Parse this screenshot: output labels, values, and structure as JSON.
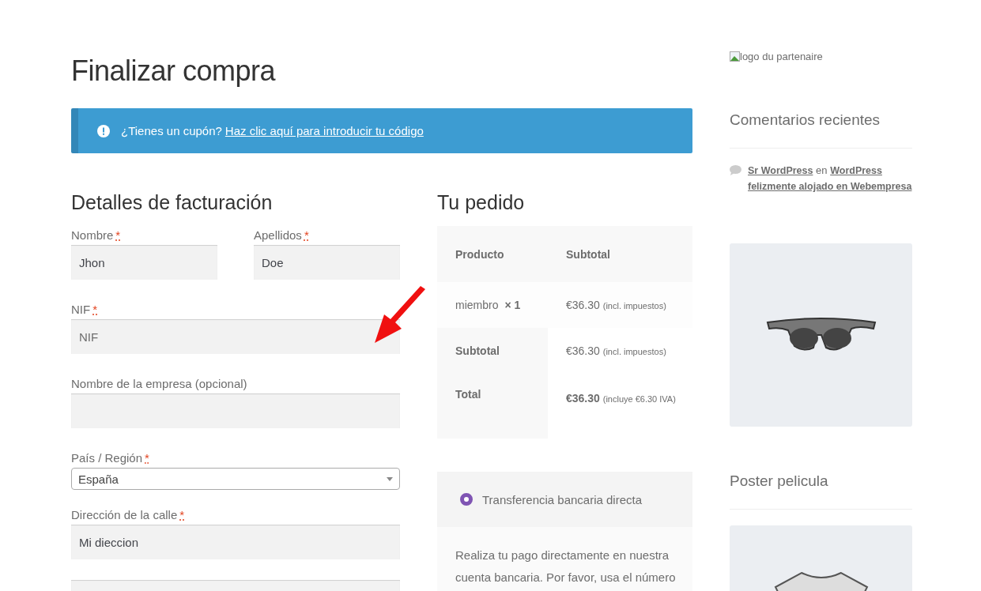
{
  "page_title": "Finalizar compra",
  "notice": {
    "text": "¿Tienes un cupón?",
    "link": "Haz clic aquí para introducir tu código"
  },
  "required_mark": "*",
  "billing": {
    "heading": "Detalles de facturación",
    "rows": [
      [
        {
          "kind": "text",
          "label": "Nombre",
          "required": true,
          "value": "Jhon"
        },
        {
          "kind": "text",
          "label": "Apellidos",
          "required": true,
          "value": "Doe"
        }
      ],
      [
        {
          "kind": "text",
          "label": "NIF",
          "required": true,
          "placeholder": "NIF"
        }
      ],
      [
        {
          "kind": "text",
          "label": "Nombre de la empresa (opcional)",
          "required": false
        }
      ],
      [
        {
          "kind": "select",
          "label": "País / Región",
          "required": true,
          "value": "España"
        }
      ],
      [
        {
          "kind": "text",
          "label": "Dirección de la calle",
          "required": true,
          "value": "Mi dieccion"
        }
      ],
      [
        {
          "kind": "text"
        }
      ]
    ]
  },
  "order": {
    "heading": "Tu pedido",
    "columns": [
      "Producto",
      "Subtotal"
    ],
    "items": [
      {
        "product": "miembro",
        "qty": "× 1",
        "price": "€36.30",
        "note": "(incl. impuestos)"
      }
    ],
    "totals": [
      {
        "label": "Subtotal",
        "price": "€36.30",
        "note": "(incl. impuestos)",
        "bold": false
      },
      {
        "label": "Total",
        "price": "€36.30",
        "note": "(incluye €6.30 IVA)",
        "bold": true
      }
    ]
  },
  "payment": {
    "methods": [
      {
        "label": "Transferencia bancaria directa",
        "selected": true
      }
    ],
    "description": "Realiza tu pago directamente en nuestra cuenta bancaria. Por favor, usa el número"
  },
  "sidebar": {
    "logo_alt": "logo du partenaire",
    "comments_heading": "Comentarios recientes",
    "comments": [
      {
        "author": "Sr WordPress",
        "joiner": "en",
        "post": "WordPress felizmente alojado en Webempresa"
      }
    ],
    "poster_heading": "Poster pelicula"
  }
}
